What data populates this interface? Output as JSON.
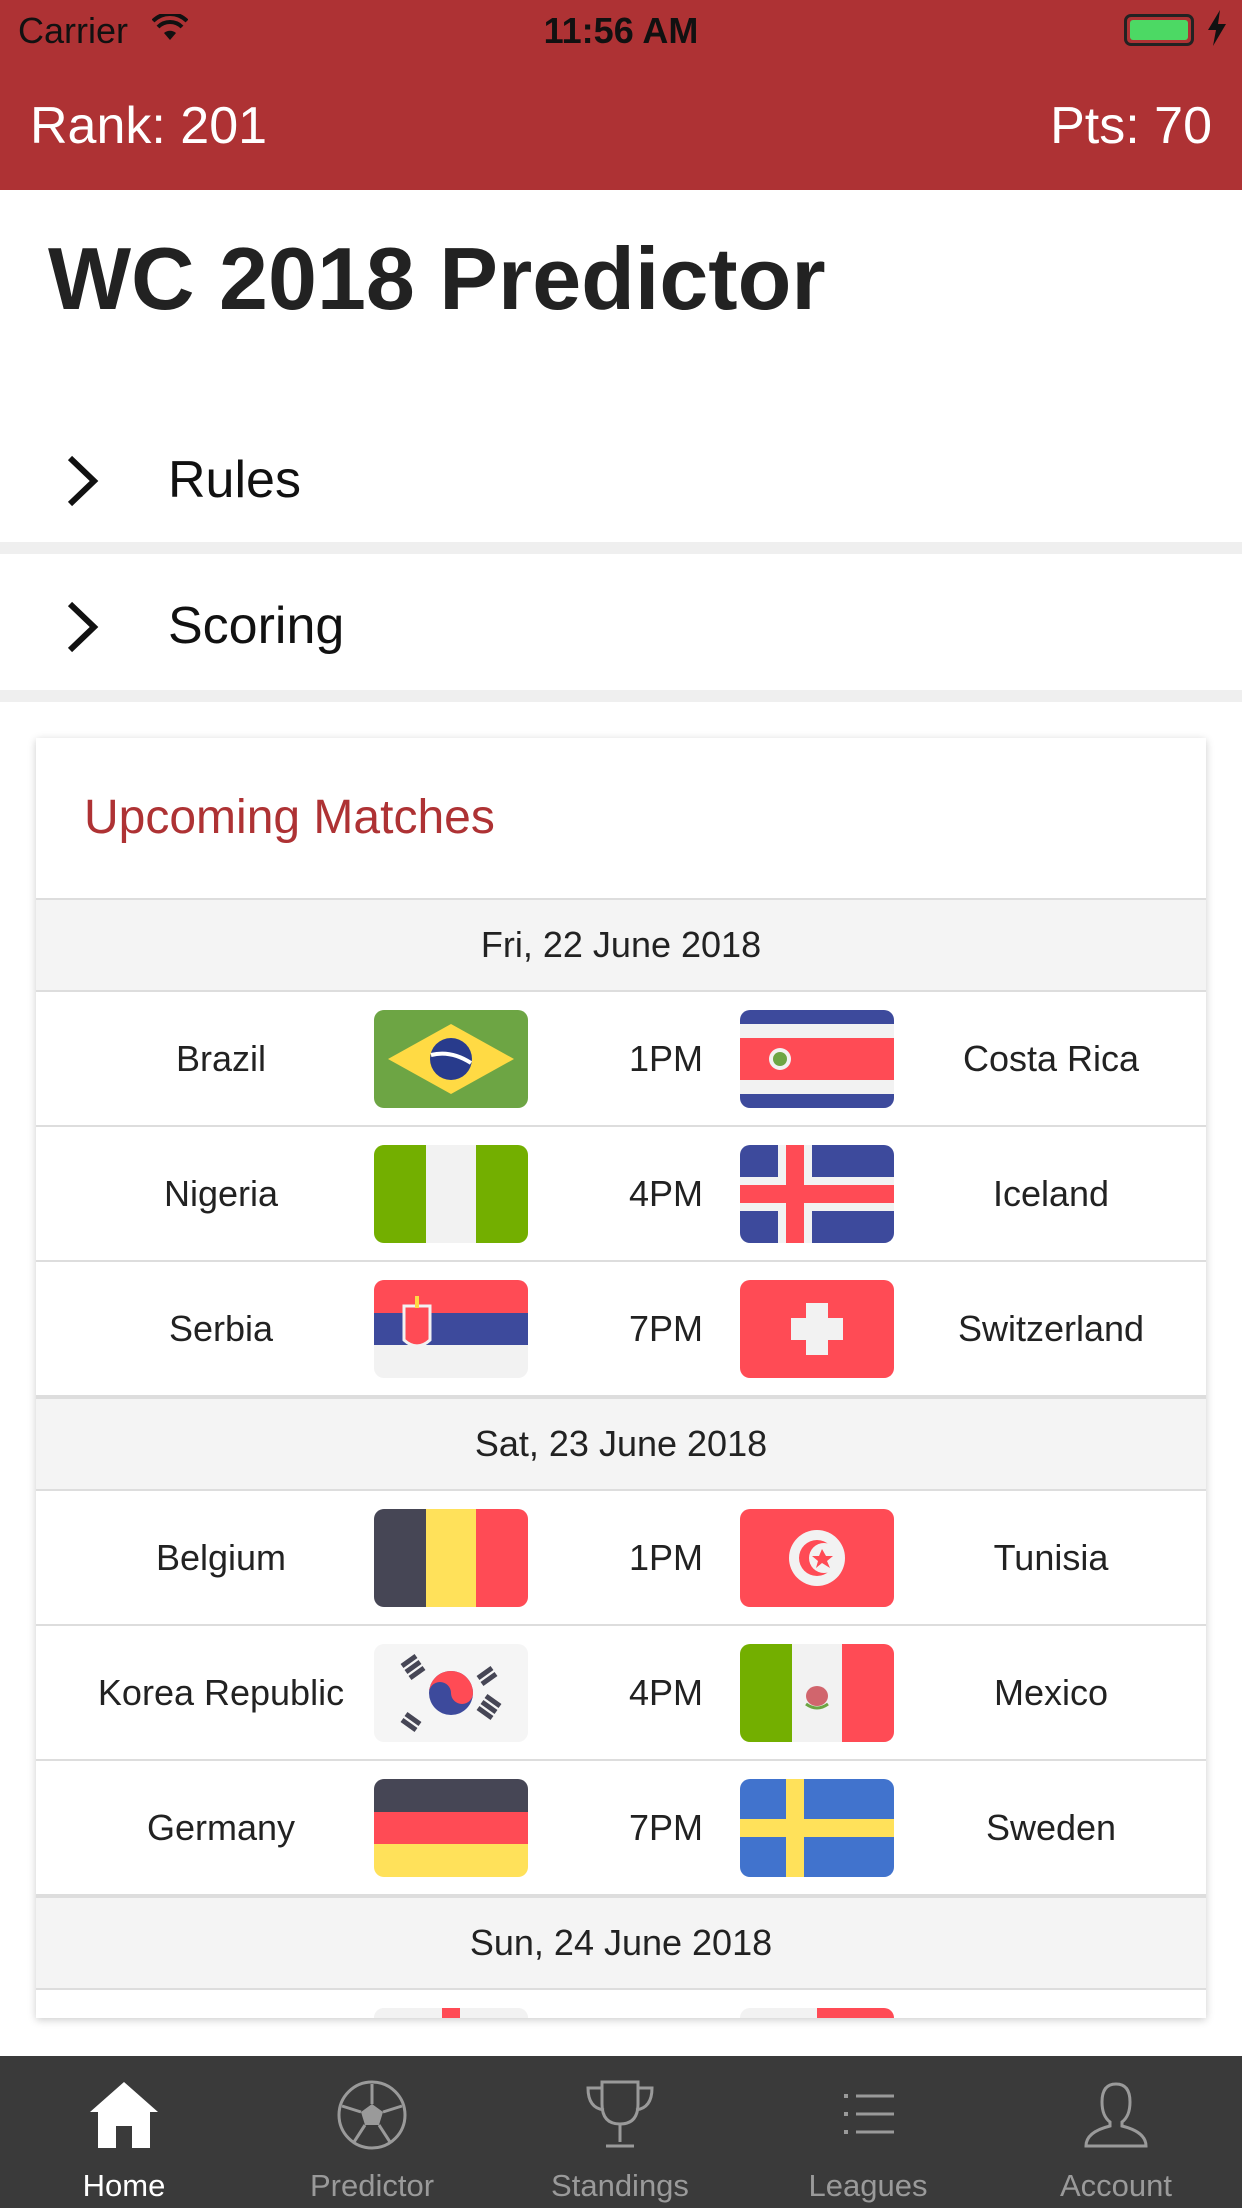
{
  "status_bar": {
    "carrier": "Carrier",
    "time": "11:56 AM"
  },
  "header": {
    "rank": "Rank: 201",
    "points": "Pts: 70"
  },
  "page_title": "WC 2018 Predictor",
  "accordions": [
    {
      "label": "Rules"
    },
    {
      "label": "Scoring"
    }
  ],
  "upcoming": {
    "title": "Upcoming Matches",
    "days": [
      {
        "date": "Fri, 22 June 2018",
        "matches": [
          {
            "home": "Brazil",
            "home_flag": "brazil-flag",
            "time": "1PM",
            "away": "Costa Rica",
            "away_flag": "costa-rica-flag"
          },
          {
            "home": "Nigeria",
            "home_flag": "nigeria-flag",
            "time": "4PM",
            "away": "Iceland",
            "away_flag": "iceland-flag"
          },
          {
            "home": "Serbia",
            "home_flag": "serbia-flag",
            "time": "7PM",
            "away": "Switzerland",
            "away_flag": "switzerland-flag"
          }
        ]
      },
      {
        "date": "Sat, 23 June 2018",
        "matches": [
          {
            "home": "Belgium",
            "home_flag": "belgium-flag",
            "time": "1PM",
            "away": "Tunisia",
            "away_flag": "tunisia-flag"
          },
          {
            "home": "Korea Republic",
            "home_flag": "korea-flag",
            "time": "4PM",
            "away": "Mexico",
            "away_flag": "mexico-flag"
          },
          {
            "home": "Germany",
            "home_flag": "germany-flag",
            "time": "7PM",
            "away": "Sweden",
            "away_flag": "sweden-flag"
          }
        ]
      },
      {
        "date": "Sun, 24 June 2018",
        "matches": []
      }
    ]
  },
  "tabs": [
    {
      "label": "Home",
      "icon": "home-icon",
      "active": true
    },
    {
      "label": "Predictor",
      "icon": "soccer-ball-icon",
      "active": false
    },
    {
      "label": "Standings",
      "icon": "trophy-icon",
      "active": false
    },
    {
      "label": "Leagues",
      "icon": "list-icon",
      "active": false
    },
    {
      "label": "Account",
      "icon": "user-icon",
      "active": false
    }
  ],
  "colors": {
    "brand_red": "#ae3234",
    "tabbar_bg": "#3a3a3a",
    "date_row_bg": "#f4f4f4"
  }
}
